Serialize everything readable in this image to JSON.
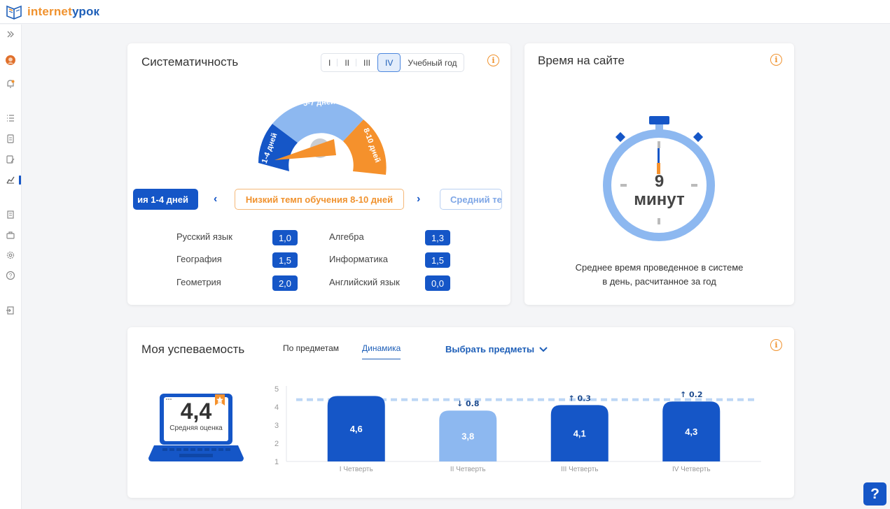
{
  "brand": {
    "name_part1": "internet",
    "name_part2": "урок"
  },
  "sidebar": {
    "icons": [
      "expand-icon",
      "avatar",
      "bell-icon",
      "list-icon",
      "clipboard-icon",
      "edit-icon",
      "chart-icon",
      "book-icon",
      "briefcase-icon",
      "gear-icon",
      "help-circle-icon",
      "logout-icon"
    ],
    "active": "chart-icon"
  },
  "systematicity": {
    "title": "Систематичность",
    "tabs": [
      "I",
      "II",
      "III",
      "IV",
      "Учебный год"
    ],
    "active_tab": "IV",
    "gauge": {
      "segments": [
        {
          "label": "1-4 дней",
          "color": "#1556c7"
        },
        {
          "label": "5-7 дней",
          "color": "#8db8f0"
        },
        {
          "label": "8-10 дней",
          "color": "#f5912c"
        }
      ]
    },
    "speeds": {
      "left": "ия 1-4 дней",
      "current": "Низкий темп обучения 8-10 дней",
      "right": "Средний те"
    },
    "subjects_left": [
      {
        "name": "Русский язык",
        "score": "1,0"
      },
      {
        "name": "География",
        "score": "1,5"
      },
      {
        "name": "Геометрия",
        "score": "2,0"
      }
    ],
    "subjects_right": [
      {
        "name": "Алгебра",
        "score": "1,3"
      },
      {
        "name": "Информатика",
        "score": "1,5"
      },
      {
        "name": "Английский язык",
        "score": "0,0"
      }
    ]
  },
  "time_on_site": {
    "title": "Время на сайте",
    "value": "9",
    "unit": "минут",
    "caption_line1": "Среднее время проведенное в системе",
    "caption_line2": "в день, расчитанное за год"
  },
  "performance": {
    "title": "Моя успеваемость",
    "tabs": [
      "По предметам",
      "Динамика"
    ],
    "active_tab": "Динамика",
    "select_label": "Выбрать предметы",
    "average_value": "4,4",
    "average_label": "Средняя оценка",
    "chart_data": {
      "type": "bar",
      "categories": [
        "I Четверть",
        "II Четверть",
        "III Четверть",
        "IV Четверть"
      ],
      "values": [
        4.6,
        3.8,
        4.1,
        4.3
      ],
      "value_labels": [
        "4,6",
        "3,8",
        "4,1",
        "4,3"
      ],
      "deltas": [
        null,
        {
          "direction": "down",
          "value": "0.8"
        },
        {
          "direction": "up",
          "value": "0.3"
        },
        {
          "direction": "up",
          "value": "0.2"
        }
      ],
      "bar_colors": [
        "#1556c7",
        "#8db8f0",
        "#1556c7",
        "#1556c7"
      ],
      "average_line": 4.4,
      "ylim": [
        1,
        5
      ],
      "yticks": [
        "1",
        "2",
        "3",
        "4",
        "5"
      ]
    }
  }
}
